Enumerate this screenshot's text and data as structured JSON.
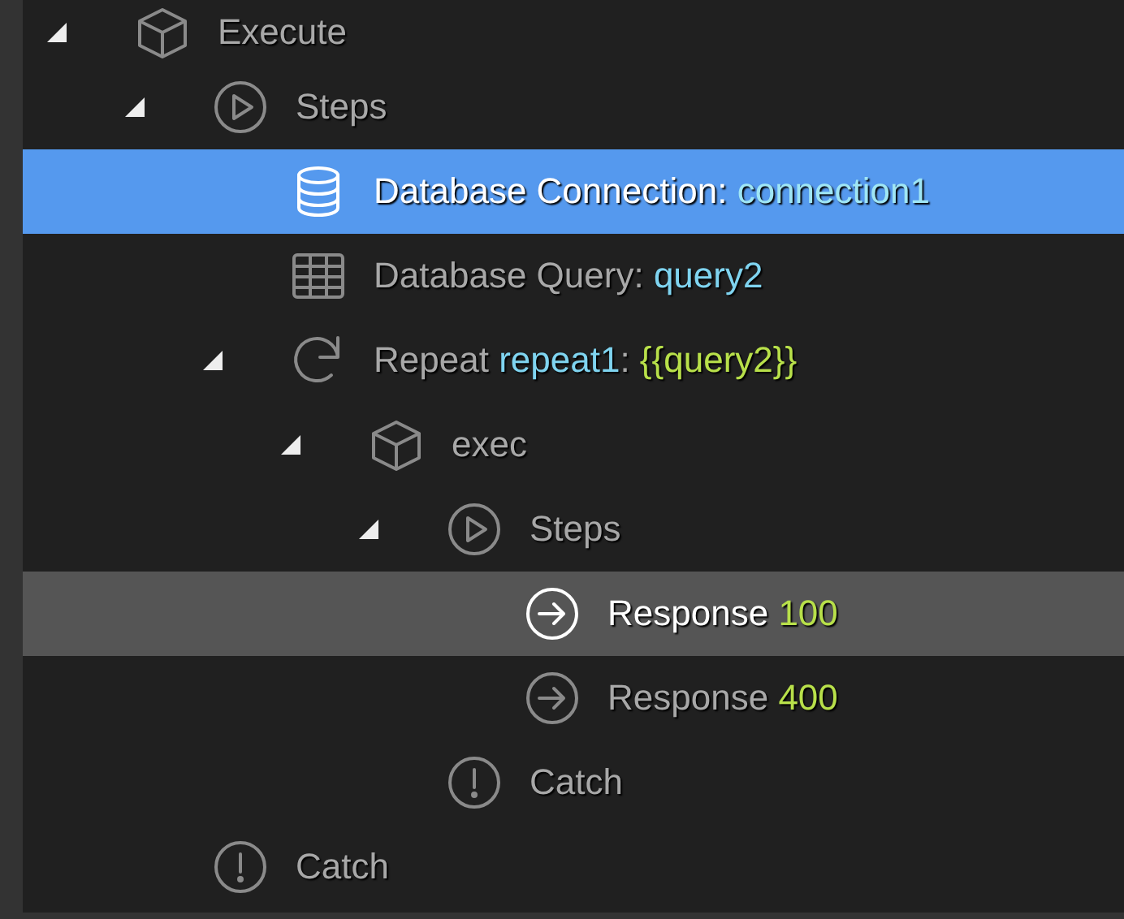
{
  "tree": [
    {
      "kind": "cube",
      "parts": [
        {
          "text": "Execute",
          "kind": "plain"
        }
      ],
      "selected": false,
      "highlighted": false,
      "expanded": true,
      "children": [
        {
          "kind": "play",
          "parts": [
            {
              "text": "Steps",
              "kind": "plain"
            }
          ],
          "selected": false,
          "highlighted": false,
          "expanded": true,
          "children": [
            {
              "kind": "database",
              "parts": [
                {
                  "text": "Database Connection: ",
                  "kind": "plain"
                },
                {
                  "text": "connection1",
                  "kind": "name"
                }
              ],
              "selected": true,
              "highlighted": false
            },
            {
              "kind": "table",
              "parts": [
                {
                  "text": "Database Query: ",
                  "kind": "plain"
                },
                {
                  "text": "query2",
                  "kind": "name"
                }
              ],
              "selected": false,
              "highlighted": false
            },
            {
              "kind": "repeat",
              "parts": [
                {
                  "text": "Repeat ",
                  "kind": "plain"
                },
                {
                  "text": "repeat1",
                  "kind": "name"
                },
                {
                  "text": ": ",
                  "kind": "plain"
                },
                {
                  "text": "{{query2}}",
                  "kind": "value"
                }
              ],
              "selected": false,
              "highlighted": false,
              "expanded": true,
              "children": [
                {
                  "kind": "cube",
                  "parts": [
                    {
                      "text": "exec",
                      "kind": "plain"
                    }
                  ],
                  "selected": false,
                  "highlighted": false,
                  "expanded": true,
                  "children": [
                    {
                      "kind": "play",
                      "parts": [
                        {
                          "text": "Steps",
                          "kind": "plain"
                        }
                      ],
                      "selected": false,
                      "highlighted": false,
                      "expanded": true,
                      "children": [
                        {
                          "kind": "arrow",
                          "parts": [
                            {
                              "text": "Response ",
                              "kind": "plain"
                            },
                            {
                              "text": "100",
                              "kind": "value"
                            }
                          ],
                          "selected": false,
                          "highlighted": true
                        },
                        {
                          "kind": "arrow",
                          "parts": [
                            {
                              "text": "Response ",
                              "kind": "plain"
                            },
                            {
                              "text": "400",
                              "kind": "value"
                            }
                          ],
                          "selected": false,
                          "highlighted": false
                        }
                      ]
                    },
                    {
                      "kind": "alert",
                      "parts": [
                        {
                          "text": "Catch",
                          "kind": "plain"
                        }
                      ],
                      "selected": false,
                      "highlighted": false
                    }
                  ]
                }
              ]
            }
          ]
        },
        {
          "kind": "alert",
          "parts": [
            {
              "text": "Catch",
              "kind": "plain"
            }
          ],
          "selected": false,
          "highlighted": false
        }
      ]
    }
  ]
}
